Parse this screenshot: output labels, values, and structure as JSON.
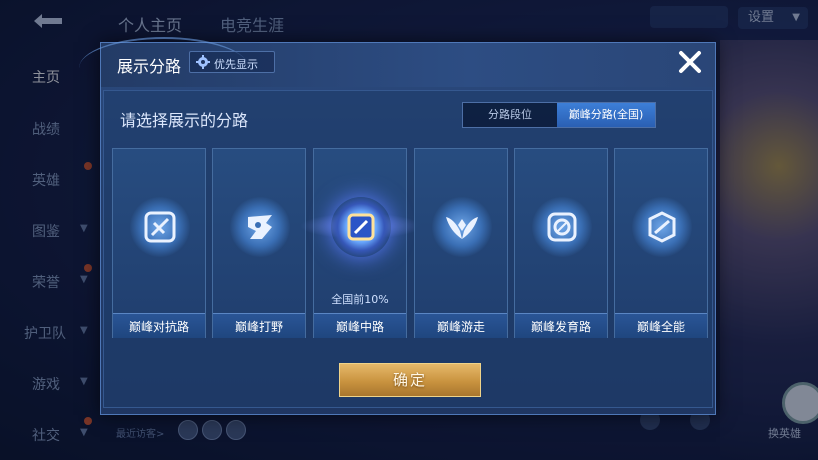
{
  "background": {
    "top_tabs": [
      "个人主页",
      "电竞生涯"
    ],
    "settings_label": "设置",
    "sidebar": [
      {
        "label": "主页",
        "active": true
      },
      {
        "label": "战绩"
      },
      {
        "label": "英雄"
      },
      {
        "label": "图鉴"
      },
      {
        "label": "荣誉"
      },
      {
        "label": "护卫队"
      },
      {
        "label": "游戏"
      },
      {
        "label": "社交"
      }
    ],
    "recent_visitors_label": "最近访客>",
    "swap_hero_label": "换英雄"
  },
  "modal": {
    "title": "展示分路",
    "priority_label": "优先显示",
    "prompt": "请选择展示的分路",
    "tabs": [
      {
        "label": "分路段位",
        "active": false
      },
      {
        "label": "巅峰分路(全国)",
        "active": true
      }
    ],
    "roles": [
      {
        "name": "巅峰对抗路",
        "icon": "sword-icon",
        "rank": ""
      },
      {
        "name": "巅峰打野",
        "icon": "dragon-icon",
        "rank": ""
      },
      {
        "name": "巅峰中路",
        "icon": "staff-icon",
        "rank": "全国前10%",
        "selected": true
      },
      {
        "name": "巅峰游走",
        "icon": "wings-icon",
        "rank": ""
      },
      {
        "name": "巅峰发育路",
        "icon": "target-icon",
        "rank": ""
      },
      {
        "name": "巅峰全能",
        "icon": "allround-icon",
        "rank": ""
      }
    ],
    "confirm_label": "确定"
  },
  "colors": {
    "accent": "#3d7fd8",
    "confirm_gold": "#c9933f",
    "panel": "#243f6e"
  }
}
